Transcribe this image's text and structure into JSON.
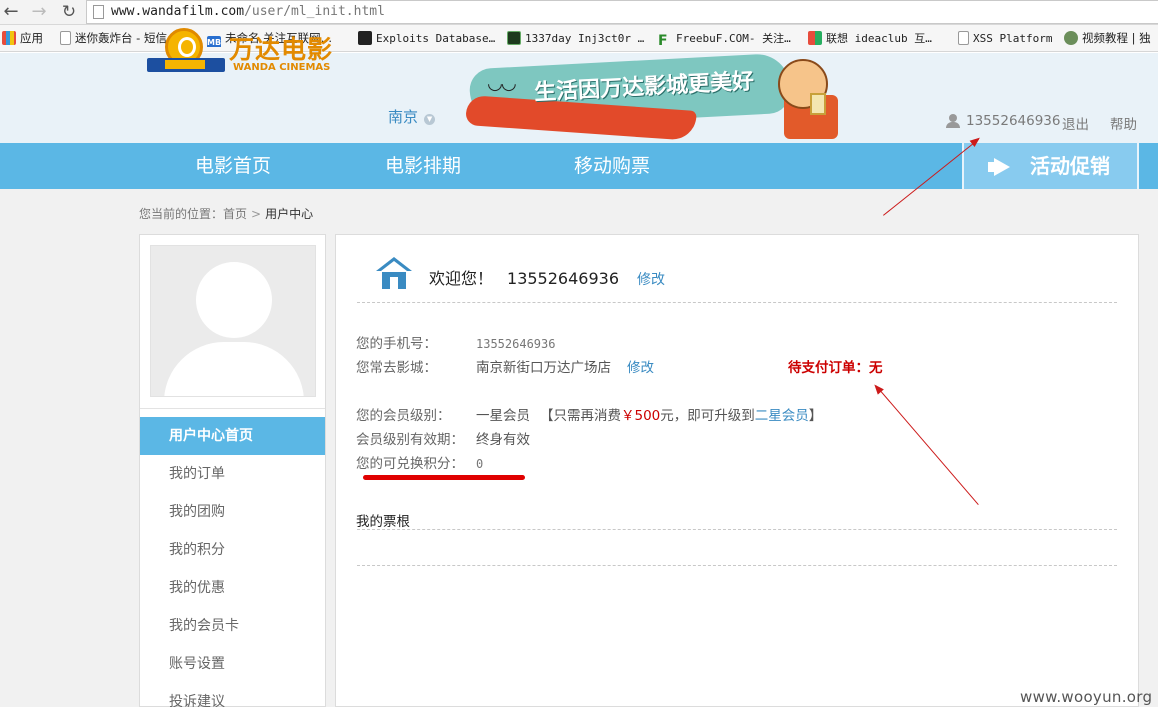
{
  "browser": {
    "url_host": "www.wandafilm.com",
    "url_path": "/user/ml_init.html",
    "bookmarks": [
      {
        "label": "应用",
        "icon": "apps-grid-icon"
      },
      {
        "label": "迷你轰炸台 - 短信…",
        "icon": "page-icon"
      },
      {
        "label": "未命名 关注互联网…",
        "icon": "mb-icon"
      },
      {
        "label": "Exploits Database…",
        "icon": "exploit-db-icon"
      },
      {
        "label": "1337day Inj3ct0r …",
        "icon": "1337day-icon"
      },
      {
        "label": "FreebuF.COM- 关注…",
        "icon": "freebuf-icon"
      },
      {
        "label": "联想 ideaclub 互…",
        "icon": "lenovo-icon"
      },
      {
        "label": "XSS Platform",
        "icon": "page-icon"
      },
      {
        "label": "视频教程 | 独",
        "icon": "avatar-icon"
      }
    ]
  },
  "header": {
    "logo_cn": "万达电影",
    "logo_en": "WANDA CINEMAS",
    "city": "南京",
    "banner_slogan": "生活因万达影城更美好",
    "user_phone": "13552646936",
    "logout": "退出",
    "help": "帮助"
  },
  "nav": {
    "items": [
      "电影首页",
      "电影排期",
      "移动购票"
    ],
    "promo": "活动促销"
  },
  "breadcrumb": {
    "prefix": "您当前的位置：",
    "home": "首页",
    "sep": ">",
    "current": "用户中心"
  },
  "sidebar": {
    "menu": [
      "用户中心首页",
      "我的订单",
      "我的团购",
      "我的积分",
      "我的优惠",
      "我的会员卡",
      "账号设置",
      "投诉建议"
    ]
  },
  "profile": {
    "welcome": "欢迎您！",
    "phone": "13552646936",
    "edit": "修改",
    "phone_label": "您的手机号：",
    "phone_value": "13552646936",
    "cinema_label": "您常去影城：",
    "cinema_value": "南京新街口万达广场店",
    "cinema_edit": "修改",
    "pending_orders": "待支付订单：无",
    "level_label": "您的会员级别：",
    "level_value": "一星会员",
    "upgrade_prefix": "【只需再消费",
    "upgrade_price": "￥500",
    "upgrade_mid": "元，即可升级到",
    "upgrade_level": "二星会员",
    "upgrade_suffix": "】",
    "validity_label": "会员级别有效期：",
    "validity_value": "终身有效",
    "points_label": "您的可兑换积分：",
    "points_value": "0",
    "tickets_title": "我的票根"
  },
  "watermark": "www.wooyun.org"
}
